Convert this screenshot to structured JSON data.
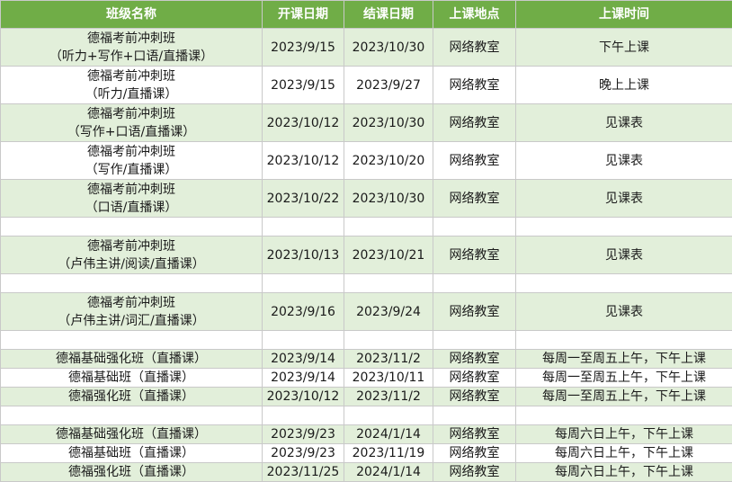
{
  "headers": [
    "班级名称",
    "开课日期",
    "结课日期",
    "上课地点",
    "上课时间"
  ],
  "rows": [
    {
      "name": [
        "德福考前冲刺班",
        "（听力+写作+口语/直播课）"
      ],
      "start": "2023/9/15",
      "end": "2023/10/30",
      "location": "网络教室",
      "time": "下午上课"
    },
    {
      "name": [
        "德福考前冲刺班",
        "（听力/直播课）"
      ],
      "start": "2023/9/15",
      "end": "2023/9/27",
      "location": "网络教室",
      "time": "晚上上课"
    },
    {
      "name": [
        "德福考前冲刺班",
        "（写作+口语/直播课）"
      ],
      "start": "2023/10/12",
      "end": "2023/10/30",
      "location": "网络教室",
      "time": "见课表"
    },
    {
      "name": [
        "德福考前冲刺班",
        "（写作/直播课）"
      ],
      "start": "2023/10/12",
      "end": "2023/10/20",
      "location": "网络教室",
      "time": "见课表"
    },
    {
      "name": [
        "德福考前冲刺班",
        "（口语/直播课）"
      ],
      "start": "2023/10/22",
      "end": "2023/10/30",
      "location": "网络教室",
      "time": "见课表"
    },
    {
      "name": [
        "德福考前冲刺班",
        "（卢伟主讲/阅读/直播课）"
      ],
      "start": "2023/10/13",
      "end": "2023/10/21",
      "location": "网络教室",
      "time": "见课表"
    },
    {
      "name": [
        "德福考前冲刺班",
        "（卢伟主讲/词汇/直播课）"
      ],
      "start": "2023/9/16",
      "end": "2023/9/24",
      "location": "网络教室",
      "time": "见课表"
    },
    {
      "name": [
        "德福基础强化班（直播课）"
      ],
      "start": "2023/9/14",
      "end": "2023/11/2",
      "location": "网络教室",
      "time": "每周一至周五上午，下午上课"
    },
    {
      "name": [
        "德福基础班（直播课）"
      ],
      "start": "2023/9/14",
      "end": "2023/10/11",
      "location": "网络教室",
      "time": "每周一至周五上午，下午上课"
    },
    {
      "name": [
        "德福强化班（直播课）"
      ],
      "start": "2023/10/12",
      "end": "2023/11/2",
      "location": "网络教室",
      "time": "每周一至周五上午，下午上课"
    },
    {
      "name": [
        "德福基础强化班（直播课）"
      ],
      "start": "2023/9/23",
      "end": "2024/1/14",
      "location": "网络教室",
      "time": "每周六日上午，下午上课"
    },
    {
      "name": [
        "德福基础班（直播课）"
      ],
      "start": "2023/9/23",
      "end": "2023/11/19",
      "location": "网络教室",
      "time": "每周六日上午，下午上课"
    },
    {
      "name": [
        "德福强化班（直播课）"
      ],
      "start": "2023/11/25",
      "end": "2024/1/14",
      "location": "网络教室",
      "time": "每周六日上午，下午上课"
    }
  ]
}
